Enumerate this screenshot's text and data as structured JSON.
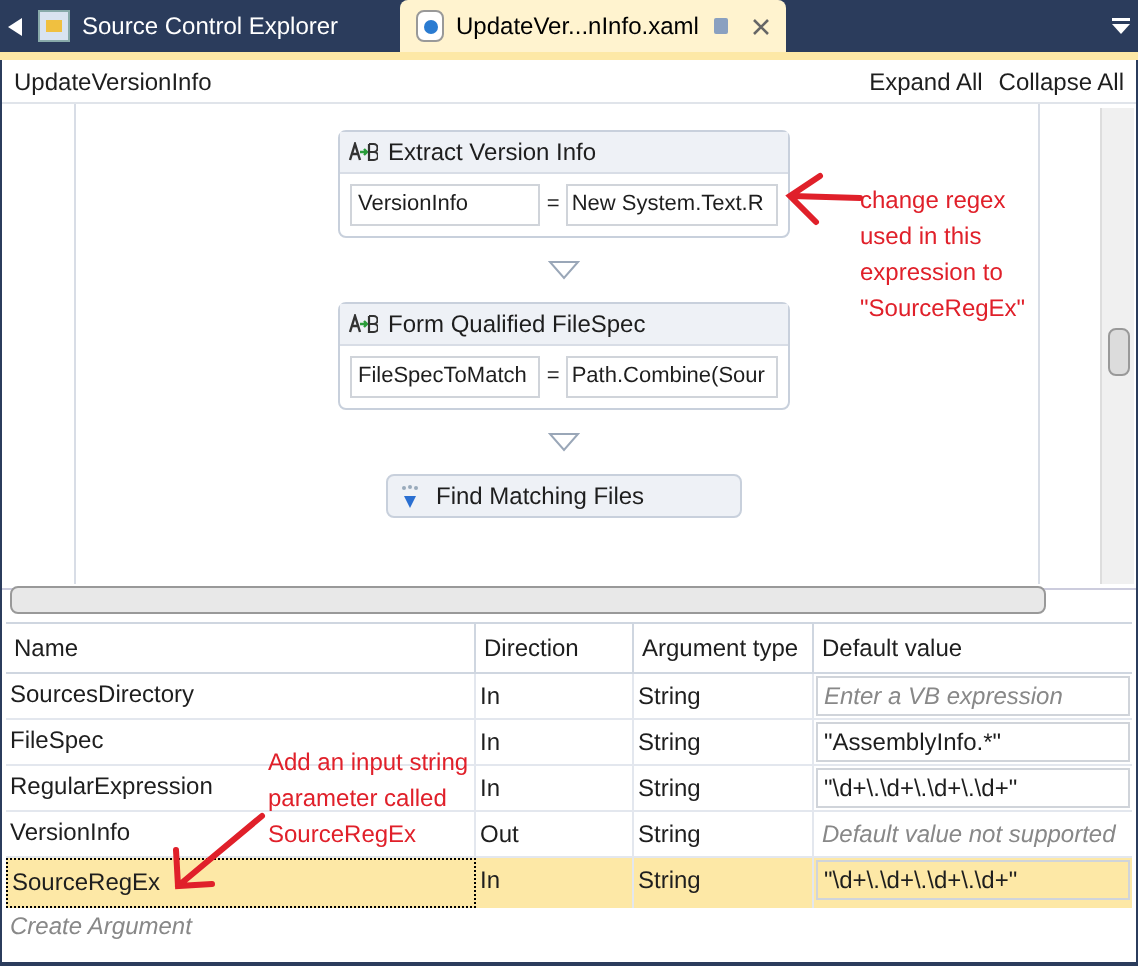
{
  "tabs": [
    {
      "label": "Source Control Explorer",
      "selected": false
    },
    {
      "label": "UpdateVer...nInfo.xaml",
      "selected": true
    }
  ],
  "header": {
    "title": "UpdateVersionInfo",
    "actions": [
      "Expand All",
      "Collapse All"
    ]
  },
  "activities": [
    {
      "kind": "assign",
      "title": "Extract Version Info",
      "to": "VersionInfo",
      "operator": "=",
      "value": "New System.Text.R"
    },
    {
      "kind": "assign",
      "title": "Form Qualified FileSpec",
      "to": "FileSpecToMatch",
      "operator": "=",
      "value": "Path.Combine(Sour"
    },
    {
      "kind": "sequence",
      "title": "Find Matching Files"
    }
  ],
  "annotations": [
    "change regex used in this expression to \"SourceRegEx\"",
    "Add an input string parameter called SourceRegEx"
  ],
  "arguments": {
    "columns": [
      "Name",
      "Direction",
      "Argument type",
      "Default value"
    ],
    "rows": [
      {
        "name": "SourcesDirectory",
        "direction": "In",
        "type": "String",
        "placeholder": "Enter a VB expression",
        "selected": false
      },
      {
        "name": "FileSpec",
        "direction": "In",
        "type": "String",
        "default": "\"AssemblyInfo.*\"",
        "selected": false
      },
      {
        "name": "RegularExpression",
        "direction": "In",
        "type": "String",
        "default": "\"\\d+\\.\\d+\\.\\d+\\.\\d+\"",
        "selected": false
      },
      {
        "name": "VersionInfo",
        "direction": "Out",
        "type": "String",
        "note": "Default value not supported",
        "selected": false
      },
      {
        "name": "SourceRegEx",
        "direction": "In",
        "type": "String",
        "default": "\"\\d+\\.\\d+\\.\\d+\\.\\d+\"",
        "selected": true
      }
    ],
    "create_label": "Create Argument"
  }
}
